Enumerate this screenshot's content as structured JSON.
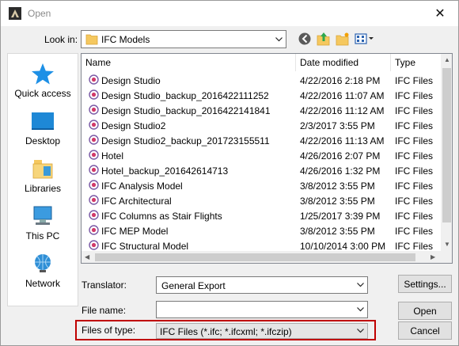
{
  "dialog": {
    "title": "Open",
    "close_glyph": "✕"
  },
  "look_in": {
    "label": "Look in:",
    "value": "IFC Models"
  },
  "places": [
    {
      "label": "Quick access",
      "icon": "quick-access-star-icon"
    },
    {
      "label": "Desktop",
      "icon": "desktop-icon"
    },
    {
      "label": "Libraries",
      "icon": "libraries-icon"
    },
    {
      "label": "This PC",
      "icon": "computer-icon"
    },
    {
      "label": "Network",
      "icon": "network-icon"
    }
  ],
  "columns": {
    "name": "Name",
    "date": "Date modified",
    "type": "Type"
  },
  "files": [
    {
      "name": "Design Studio",
      "date": "4/22/2016 2:18 PM",
      "type": "IFC Files"
    },
    {
      "name": "Design Studio_backup_2016422111252",
      "date": "4/22/2016 11:07 AM",
      "type": "IFC Files"
    },
    {
      "name": "Design Studio_backup_2016422141841",
      "date": "4/22/2016 11:12 AM",
      "type": "IFC Files"
    },
    {
      "name": "Design Studio2",
      "date": "2/3/2017 3:55 PM",
      "type": "IFC Files"
    },
    {
      "name": "Design Studio2_backup_201723155511",
      "date": "4/22/2016 11:13 AM",
      "type": "IFC Files"
    },
    {
      "name": "Hotel",
      "date": "4/26/2016 2:07 PM",
      "type": "IFC Files"
    },
    {
      "name": "Hotel_backup_201642614713",
      "date": "4/26/2016 1:32 PM",
      "type": "IFC Files"
    },
    {
      "name": "IFC Analysis Model",
      "date": "3/8/2012 3:55 PM",
      "type": "IFC Files"
    },
    {
      "name": "IFC Architectural",
      "date": "3/8/2012 3:55 PM",
      "type": "IFC Files"
    },
    {
      "name": "IFC Columns as Stair Flights",
      "date": "1/25/2017 3:39 PM",
      "type": "IFC Files"
    },
    {
      "name": "IFC MEP Model",
      "date": "3/8/2012 3:55 PM",
      "type": "IFC Files"
    },
    {
      "name": "IFC Structural Model",
      "date": "10/10/2014 3:00 PM",
      "type": "IFC Files"
    }
  ],
  "translator": {
    "label": "Translator:",
    "value": "General Export",
    "settings_button": "Settings..."
  },
  "file_name": {
    "label": "File name:",
    "value": "",
    "open_button": "Open"
  },
  "file_type": {
    "label": "Files of type:",
    "value": "IFC Files (*.ifc; *.ifcxml; *.ifczip)",
    "cancel_button": "Cancel"
  },
  "colors": {
    "highlight_border": "#c00000",
    "window_bg": "#f0f0f0"
  }
}
